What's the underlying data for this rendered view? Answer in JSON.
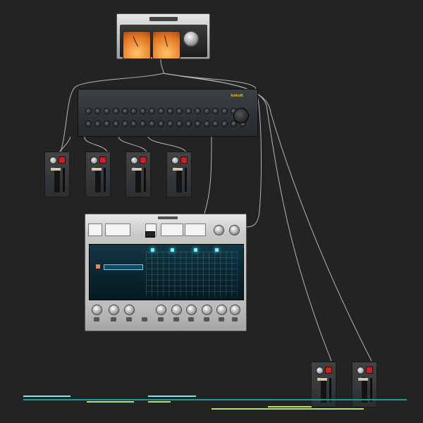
{
  "colors": {
    "background": "#232323",
    "cable": "#d6d6d6",
    "timeline_cyan": "#7fe6f2",
    "timeline_teal": "#1c9a93",
    "timeline_lime": "#b8e35c"
  },
  "devices": {
    "vu_meter": {
      "label": "",
      "icon": "vu-meter-icon"
    },
    "sequencer": {
      "brand": "kokult",
      "label": ""
    },
    "channel_strips": [
      {
        "label": ""
      },
      {
        "label": ""
      },
      {
        "label": ""
      },
      {
        "label": ""
      }
    ],
    "instrument": {
      "title": "",
      "screen_title": "",
      "clip_label": ""
    },
    "bottom_strips": [
      {
        "label": ""
      },
      {
        "label": ""
      }
    ]
  },
  "timeline": {
    "tracks": [
      {
        "color": "#7fe6f2",
        "start": 33,
        "end": 100
      },
      {
        "color": "#7fe6f2",
        "start": 210,
        "end": 278
      },
      {
        "color": "#1c9a93",
        "start": 33,
        "end": 577
      },
      {
        "color": "#b8e35c",
        "start": 123,
        "end": 190
      },
      {
        "color": "#b8e35c",
        "start": 210,
        "end": 242
      },
      {
        "color": "#b8e35c",
        "start": 380,
        "end": 442
      },
      {
        "color": "#b8e35c",
        "start": 300,
        "end": 516
      }
    ]
  }
}
